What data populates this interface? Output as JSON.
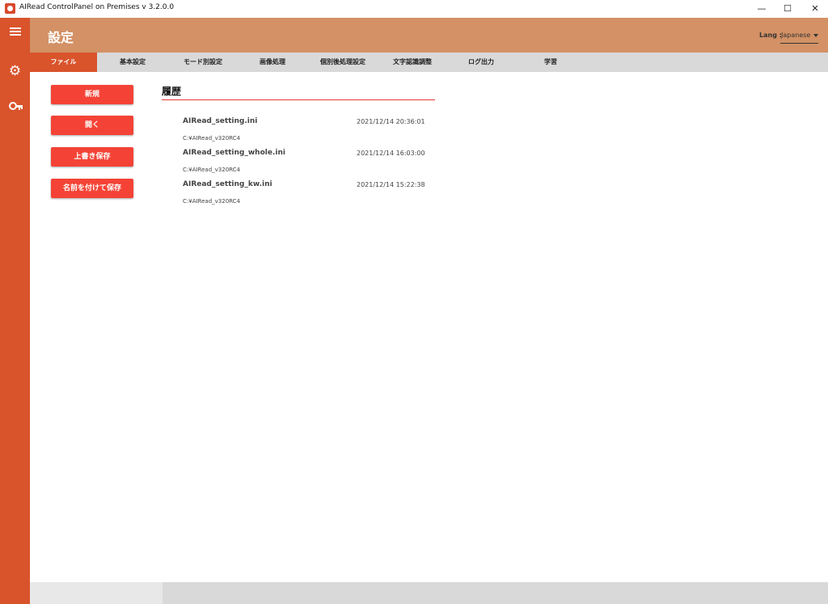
{
  "window": {
    "title": "AIRead ControlPanel on Premises v 3.2.0.0",
    "min": "—",
    "max": "☐",
    "close": "✕"
  },
  "sidebar": {
    "icons": [
      "hamburger-icon",
      "gear-icon",
      "key-icon"
    ]
  },
  "header": {
    "title": "設定",
    "lang_label": "Lang :",
    "lang_value": "Japanese"
  },
  "tabs": [
    {
      "label": "ファイル"
    },
    {
      "label": "基本設定"
    },
    {
      "label": "モード別設定"
    },
    {
      "label": "画像処理"
    },
    {
      "label": "個別後処理設定"
    },
    {
      "label": "文字認識調整"
    },
    {
      "label": "ログ出力"
    },
    {
      "label": "学習"
    }
  ],
  "actions": {
    "new": "新規",
    "open": "開く",
    "overwrite": "上書き保存",
    "save_as": "名前を付けて保存"
  },
  "history": {
    "title": "履歴",
    "items": [
      {
        "name": "AIRead_setting.ini",
        "date": "2021/12/14 20:36:01",
        "path": "C:¥AIRead_v320RC4"
      },
      {
        "name": "AIRead_setting_whole.ini",
        "date": "2021/12/14 16:03:00",
        "path": "C:¥AIRead_v320RC4"
      },
      {
        "name": "AIRead_setting_kw.ini",
        "date": "2021/12/14 15:22:38",
        "path": "C:¥AIRead_v320RC4"
      }
    ]
  },
  "colors": {
    "accent": "#d9532b",
    "header": "#d39165",
    "button": "#f44336"
  }
}
